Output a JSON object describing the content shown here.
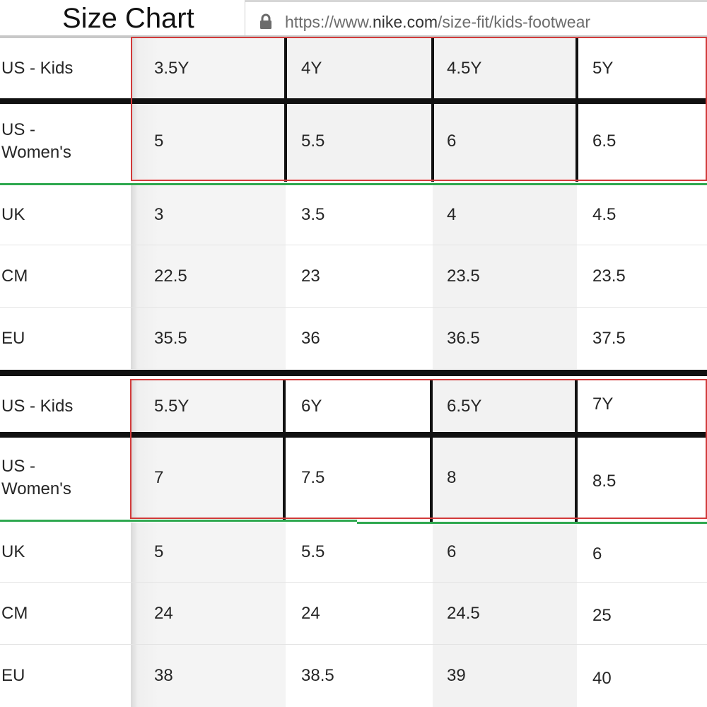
{
  "title": "Size Chart",
  "url": {
    "prefix": "https://www.",
    "domain": "nike.com",
    "path": "/size-fit/kids-footwear",
    "icon": "lock-icon"
  },
  "colors": {
    "highlight_box": "#d23a3a",
    "divider_green": "#2ea84f"
  },
  "tables": [
    {
      "rows": [
        {
          "label": "US - Kids",
          "values": [
            "3.5Y",
            "4Y",
            "4.5Y",
            "5Y"
          ]
        },
        {
          "label": "US - Women's",
          "values": [
            "5",
            "5.5",
            "6",
            "6.5"
          ]
        },
        {
          "label": "UK",
          "values": [
            "3",
            "3.5",
            "4",
            "4.5"
          ]
        },
        {
          "label": "CM",
          "values": [
            "22.5",
            "23",
            "23.5",
            "23.5"
          ]
        },
        {
          "label": "EU",
          "values": [
            "35.5",
            "36",
            "36.5",
            "37.5"
          ]
        }
      ]
    },
    {
      "rows": [
        {
          "label": "US - Kids",
          "values": [
            "5.5Y",
            "6Y",
            "6.5Y",
            "7Y"
          ]
        },
        {
          "label": "US - Women's",
          "values": [
            "7",
            "7.5",
            "8",
            "8.5"
          ]
        },
        {
          "label": "UK",
          "values": [
            "5",
            "5.5",
            "6",
            "6"
          ]
        },
        {
          "label": "CM",
          "values": [
            "24",
            "24",
            "24.5",
            "25"
          ]
        },
        {
          "label": "EU",
          "values": [
            "38",
            "38.5",
            "39",
            "40"
          ]
        }
      ]
    }
  ]
}
